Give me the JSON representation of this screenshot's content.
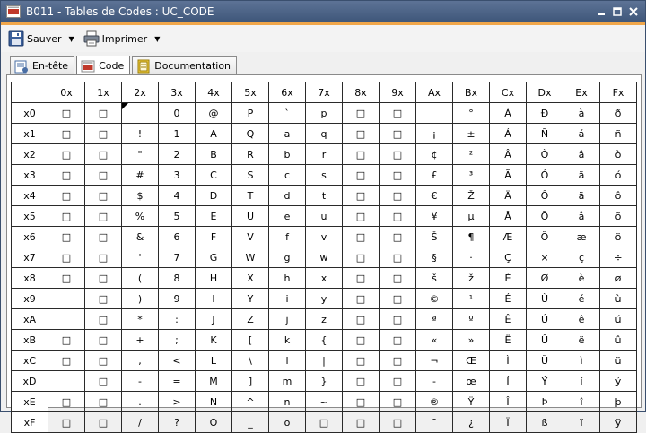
{
  "window": {
    "title": "B011 - Tables de Codes : UC_CODE"
  },
  "colors": {
    "titlebar": "#4e6588",
    "accent": "#f0a64a",
    "icon_red": "#c0392b"
  },
  "toolbar": {
    "save_label": "Sauver",
    "print_label": "Imprimer"
  },
  "tabs": [
    {
      "label": "En-tête",
      "icon": "header-icon"
    },
    {
      "label": "Code",
      "icon": "code-table-icon",
      "active": true
    },
    {
      "label": "Documentation",
      "icon": "book-icon"
    }
  ],
  "table": {
    "columns": [
      "0x",
      "1x",
      "2x",
      "3x",
      "4x",
      "5x",
      "6x",
      "7x",
      "8x",
      "9x",
      "Ax",
      "Bx",
      "Cx",
      "Dx",
      "Ex",
      "Fx"
    ],
    "rows": [
      {
        "label": "x0",
        "cells": [
          "□",
          "□",
          "",
          "0",
          "@",
          "P",
          "`",
          "p",
          "□",
          "□",
          "",
          "°",
          "À",
          "Ð",
          "à",
          "ð"
        ]
      },
      {
        "label": "x1",
        "cells": [
          "□",
          "□",
          "!",
          "1",
          "A",
          "Q",
          "a",
          "q",
          "□",
          "□",
          "¡",
          "±",
          "Á",
          "Ñ",
          "á",
          "ñ"
        ]
      },
      {
        "label": "x2",
        "cells": [
          "□",
          "□",
          "\"",
          "2",
          "B",
          "R",
          "b",
          "r",
          "□",
          "□",
          "¢",
          "²",
          "Â",
          "Ò",
          "â",
          "ò"
        ]
      },
      {
        "label": "x3",
        "cells": [
          "□",
          "□",
          "#",
          "3",
          "C",
          "S",
          "c",
          "s",
          "□",
          "□",
          "£",
          "³",
          "Ã",
          "Ó",
          "ã",
          "ó"
        ]
      },
      {
        "label": "x4",
        "cells": [
          "□",
          "□",
          "$",
          "4",
          "D",
          "T",
          "d",
          "t",
          "□",
          "□",
          "€",
          "Ž",
          "Ä",
          "Ô",
          "ä",
          "ô"
        ]
      },
      {
        "label": "x5",
        "cells": [
          "□",
          "□",
          "%",
          "5",
          "E",
          "U",
          "e",
          "u",
          "□",
          "□",
          "¥",
          "µ",
          "Å",
          "Õ",
          "å",
          "õ"
        ]
      },
      {
        "label": "x6",
        "cells": [
          "□",
          "□",
          "&",
          "6",
          "F",
          "V",
          "f",
          "v",
          "□",
          "□",
          "Š",
          "¶",
          "Æ",
          "Ö",
          "æ",
          "ö"
        ]
      },
      {
        "label": "x7",
        "cells": [
          "□",
          "□",
          "'",
          "7",
          "G",
          "W",
          "g",
          "w",
          "□",
          "□",
          "§",
          "·",
          "Ç",
          "×",
          "ç",
          "÷"
        ]
      },
      {
        "label": "x8",
        "cells": [
          "□",
          "□",
          "(",
          "8",
          "H",
          "X",
          "h",
          "x",
          "□",
          "□",
          "š",
          "ž",
          "È",
          "Ø",
          "è",
          "ø"
        ]
      },
      {
        "label": "x9",
        "cells": [
          "",
          "□",
          ")",
          "9",
          "I",
          "Y",
          "i",
          "y",
          "□",
          "□",
          "©",
          "¹",
          "É",
          "Ù",
          "é",
          "ù"
        ]
      },
      {
        "label": "xA",
        "cells": [
          "",
          "□",
          "*",
          ":",
          "J",
          "Z",
          "j",
          "z",
          "□",
          "□",
          "ª",
          "º",
          "Ê",
          "Ú",
          "ê",
          "ú"
        ]
      },
      {
        "label": "xB",
        "cells": [
          "□",
          "□",
          "+",
          ";",
          "K",
          "[",
          "k",
          "{",
          "□",
          "□",
          "«",
          "»",
          "Ë",
          "Û",
          "ë",
          "û"
        ]
      },
      {
        "label": "xC",
        "cells": [
          "□",
          "□",
          ",",
          "<",
          "L",
          "\\",
          "l",
          "|",
          "□",
          "□",
          "¬",
          "Œ",
          "Ì",
          "Ü",
          "ì",
          "ü"
        ]
      },
      {
        "label": "xD",
        "cells": [
          "",
          "□",
          "-",
          "=",
          "M",
          "]",
          "m",
          "}",
          "□",
          "□",
          "-",
          "œ",
          "Í",
          "Ý",
          "í",
          "ý"
        ]
      },
      {
        "label": "xE",
        "cells": [
          "□",
          "□",
          ".",
          ">",
          "N",
          "^",
          "n",
          "~",
          "□",
          "□",
          "®",
          "Ÿ",
          "Î",
          "Þ",
          "î",
          "þ"
        ]
      },
      {
        "label": "xF",
        "cells": [
          "□",
          "□",
          "/",
          "?",
          "O",
          "_",
          "o",
          "□",
          "□",
          "□",
          "¯",
          "¿",
          "Ï",
          "ß",
          "ï",
          "ÿ"
        ]
      }
    ]
  }
}
